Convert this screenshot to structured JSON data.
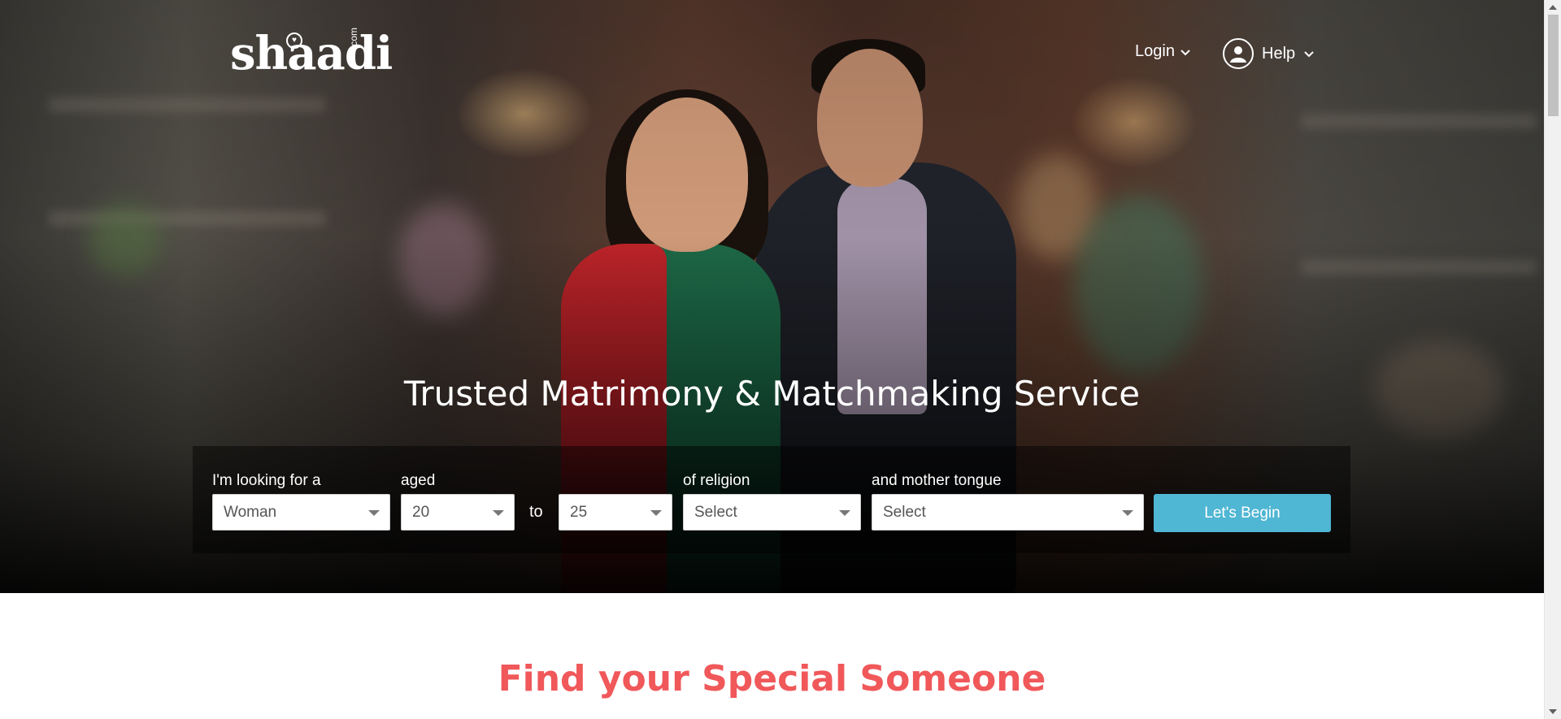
{
  "header": {
    "logo_text": "shaadi",
    "logo_suffix": ".com",
    "login_label": "Login",
    "help_label": "Help"
  },
  "hero": {
    "headline": "Trusted Matrimony & Matchmaking Service"
  },
  "search": {
    "looking_for_label": "I'm looking for a",
    "looking_for_value": "Woman",
    "aged_label": "aged",
    "age_from_value": "20",
    "to_label": "to",
    "age_to_value": "25",
    "religion_label": "of religion",
    "religion_value": "Select",
    "mother_tongue_label": "and mother tongue",
    "mother_tongue_value": "Select",
    "submit_label": "Let's Begin"
  },
  "section": {
    "title": "Find your Special Someone"
  },
  "colors": {
    "accent_button": "#4fb6d3",
    "section_title": "#f0585a"
  }
}
